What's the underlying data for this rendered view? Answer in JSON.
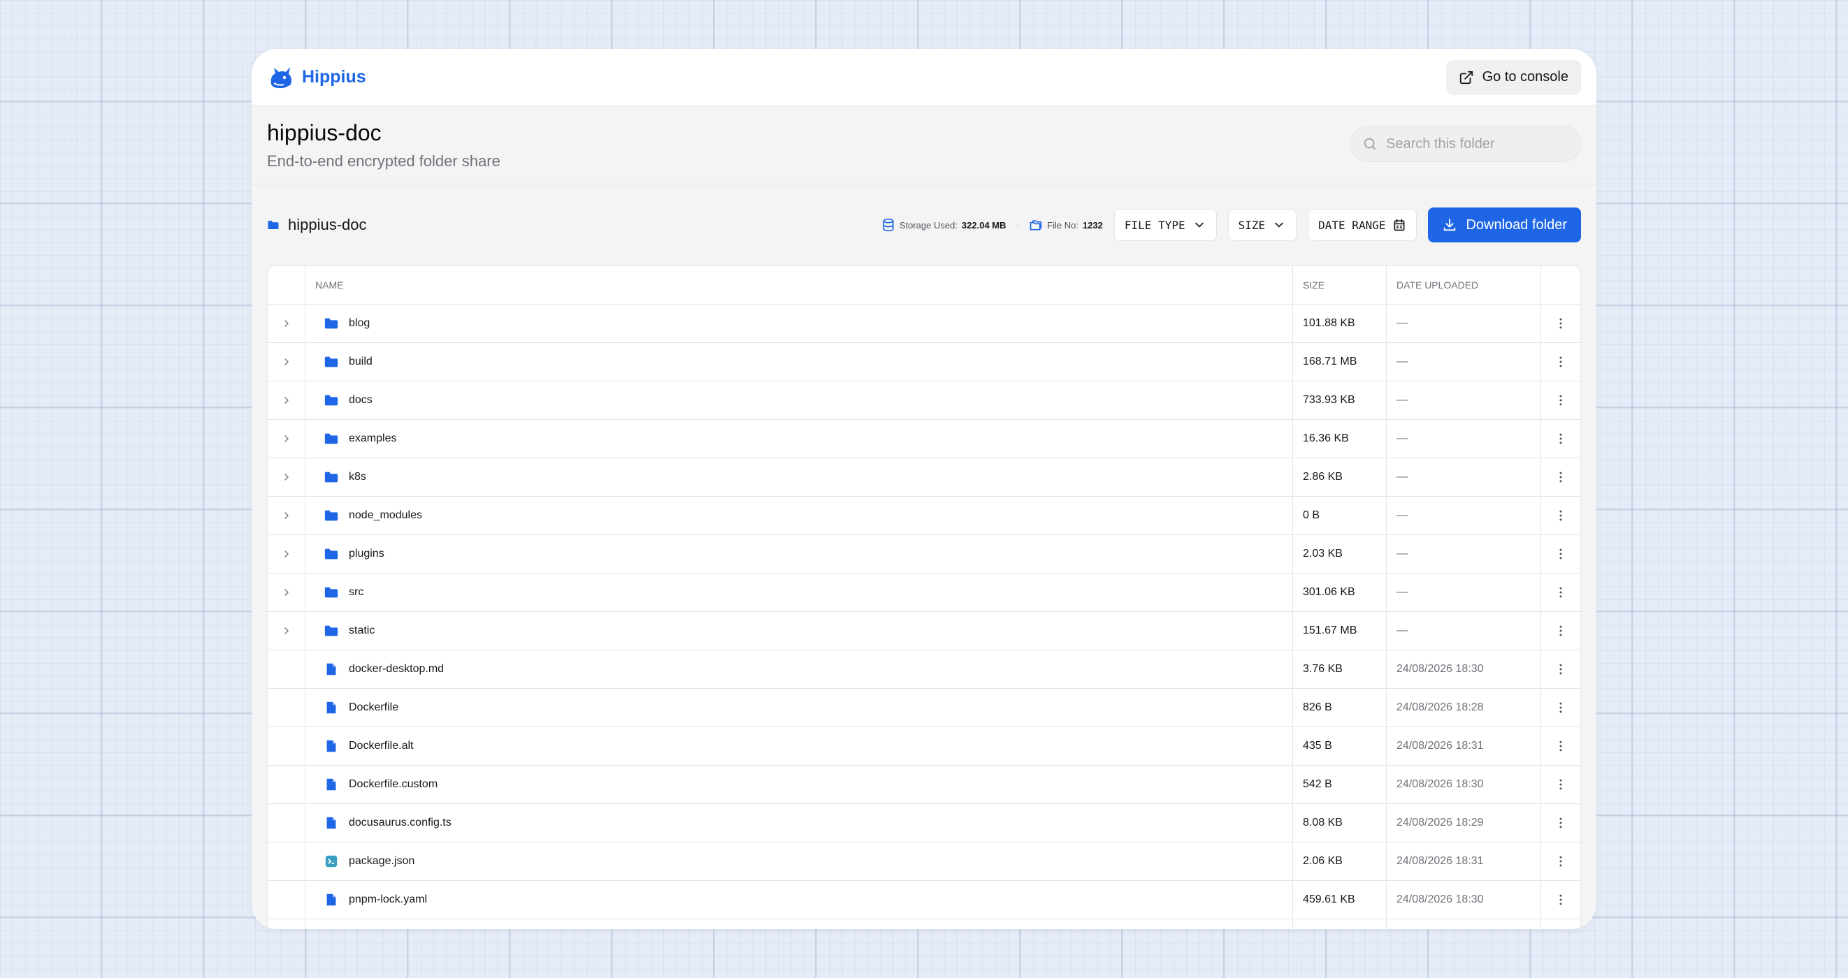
{
  "app": {
    "brand": "Hippius",
    "console_label": "Go to console"
  },
  "folder": {
    "title": "hippius-doc",
    "subtitle": "End-to-end encrypted folder share",
    "search_placeholder": "Search this folder",
    "crumb": "hippius-doc"
  },
  "stats": {
    "storage_label": "Storage Used:",
    "storage_value": "322.04 MB",
    "separator": "·",
    "files_label": "File No:",
    "files_value": "1232"
  },
  "filters": {
    "file_type": "FILE TYPE",
    "size": "SIZE",
    "date_range": "DATE RANGE"
  },
  "download_label": "Download folder",
  "table": {
    "headers": {
      "name": "NAME",
      "size": "SIZE",
      "date": "DATE UPLOADED"
    },
    "rows": [
      {
        "name": "blog",
        "size": "101.88 KB",
        "date": "—",
        "kind": "folder"
      },
      {
        "name": "build",
        "size": "168.71 MB",
        "date": "—",
        "kind": "folder"
      },
      {
        "name": "docs",
        "size": "733.93 KB",
        "date": "—",
        "kind": "folder"
      },
      {
        "name": "examples",
        "size": "16.36 KB",
        "date": "—",
        "kind": "folder"
      },
      {
        "name": "k8s",
        "size": "2.86 KB",
        "date": "—",
        "kind": "folder"
      },
      {
        "name": "node_modules",
        "size": "0 B",
        "date": "—",
        "kind": "folder"
      },
      {
        "name": "plugins",
        "size": "2.03 KB",
        "date": "—",
        "kind": "folder"
      },
      {
        "name": "src",
        "size": "301.06 KB",
        "date": "—",
        "kind": "folder"
      },
      {
        "name": "static",
        "size": "151.67 MB",
        "date": "—",
        "kind": "folder"
      },
      {
        "name": "docker-desktop.md",
        "size": "3.76 KB",
        "date": "24/08/2026 18:30",
        "kind": "file"
      },
      {
        "name": "Dockerfile",
        "size": "826 B",
        "date": "24/08/2026 18:28",
        "kind": "file"
      },
      {
        "name": "Dockerfile.alt",
        "size": "435 B",
        "date": "24/08/2026 18:31",
        "kind": "file"
      },
      {
        "name": "Dockerfile.custom",
        "size": "542 B",
        "date": "24/08/2026 18:30",
        "kind": "file"
      },
      {
        "name": "docusaurus.config.ts",
        "size": "8.08 KB",
        "date": "24/08/2026 18:29",
        "kind": "file"
      },
      {
        "name": "package.json",
        "size": "2.06 KB",
        "date": "24/08/2026 18:31",
        "kind": "json"
      },
      {
        "name": "pnpm-lock.yaml",
        "size": "459.61 KB",
        "date": "24/08/2026 18:30",
        "kind": "file"
      },
      {
        "name": "",
        "size": "",
        "date": "",
        "kind": "file"
      }
    ]
  },
  "colors": {
    "accent": "#1e66e6",
    "json_icon": "#3b9fc0",
    "background": "#e6ecf7"
  }
}
